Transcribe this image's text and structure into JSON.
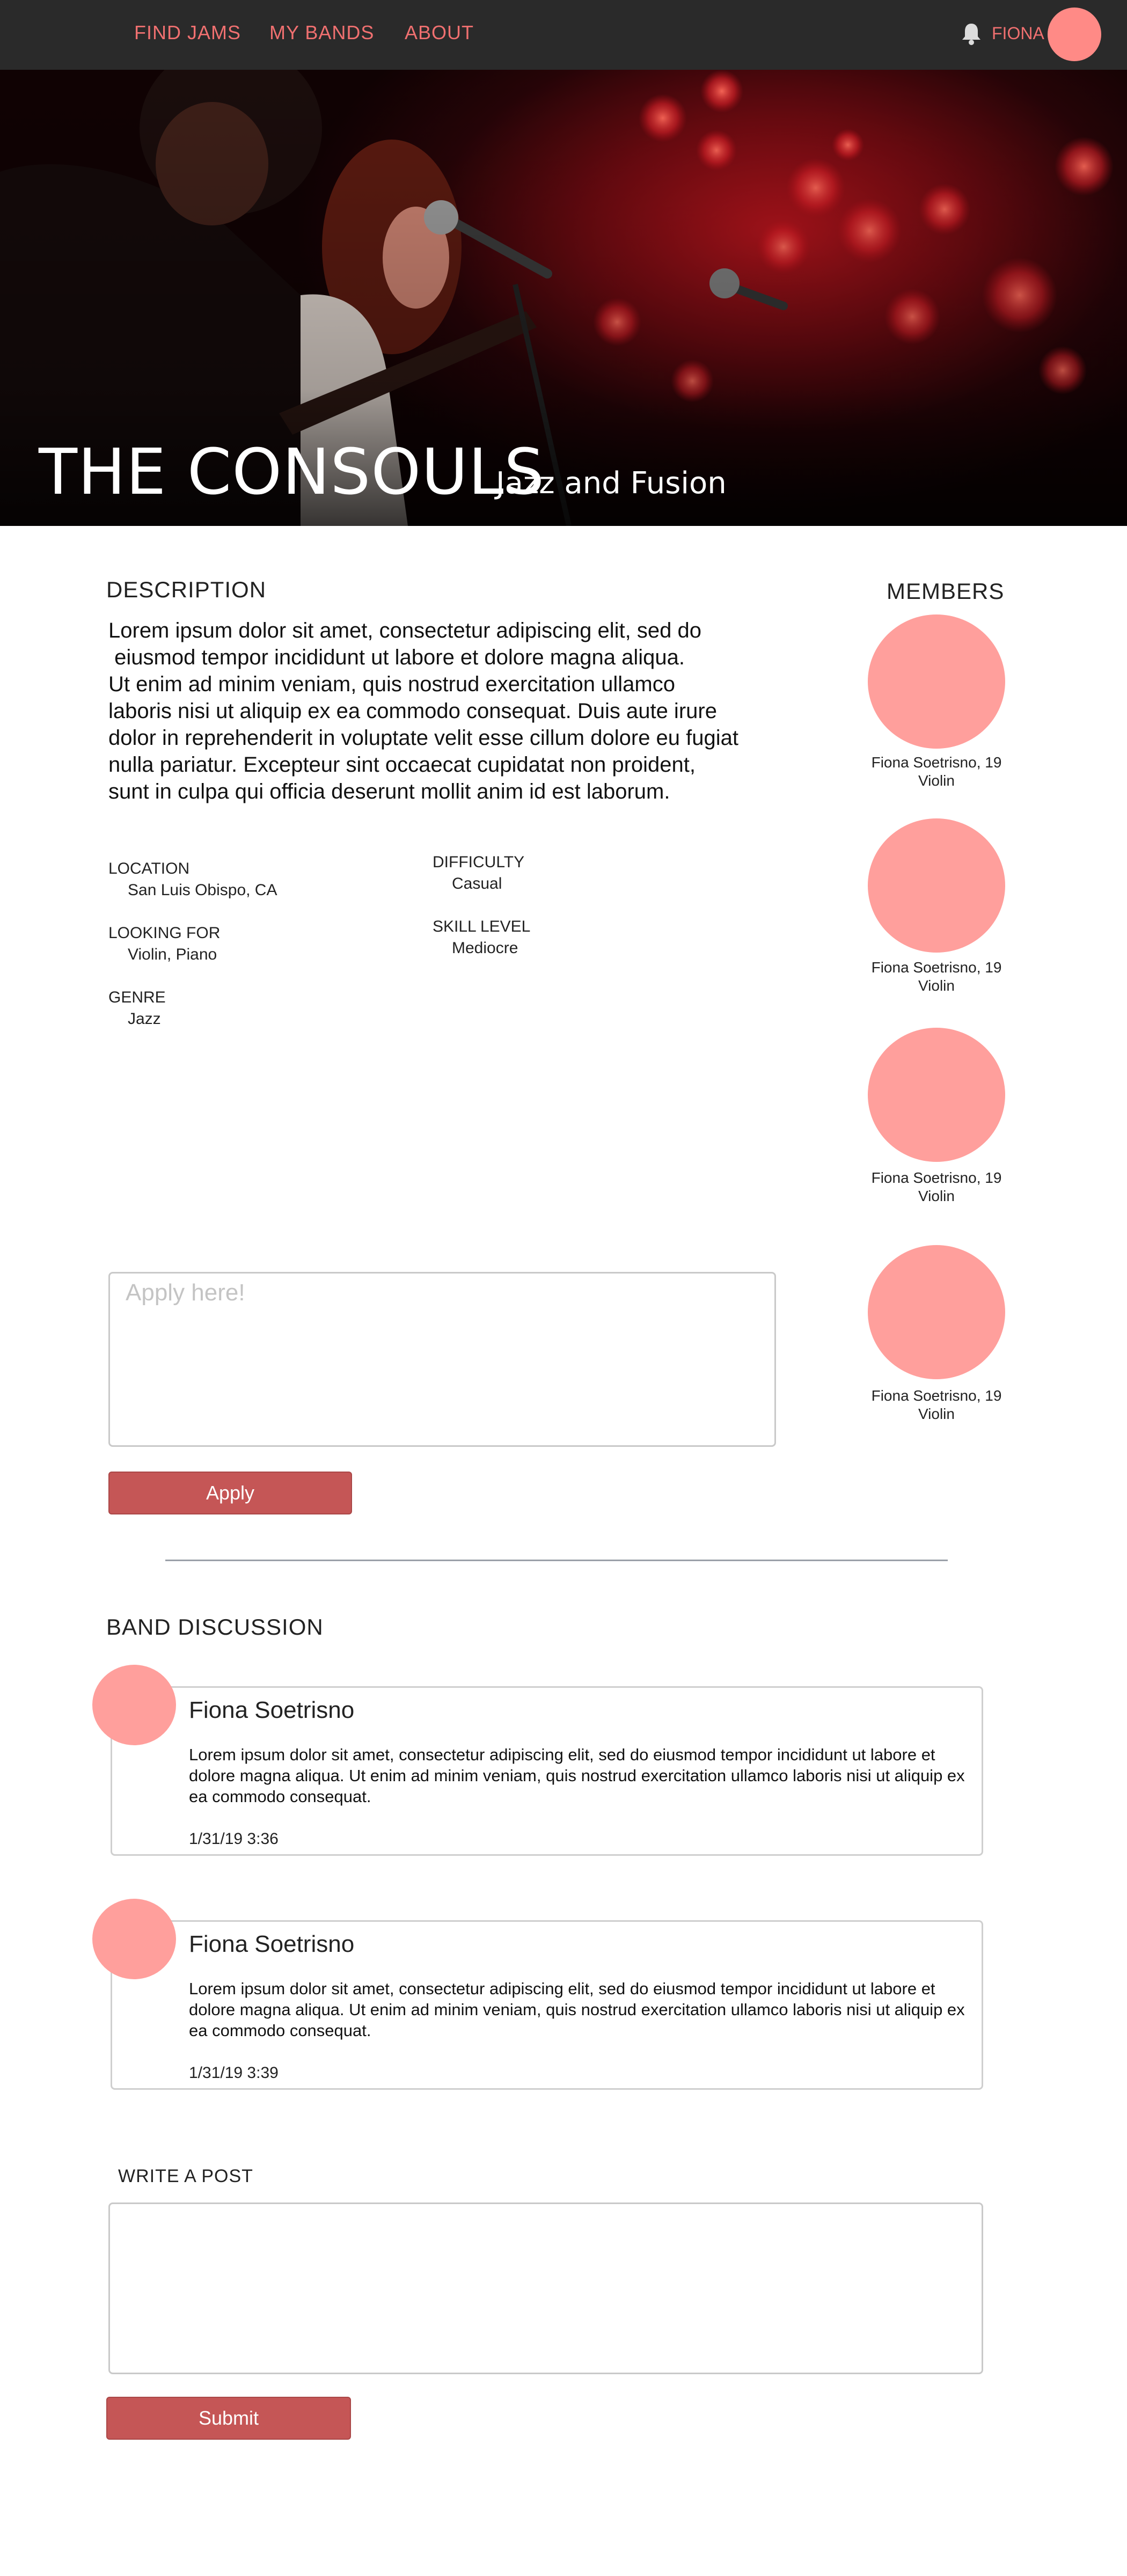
{
  "nav": {
    "links": [
      "FIND JAMS",
      "MY BANDS",
      "ABOUT"
    ],
    "user_name": "FIONA",
    "bell_icon": "bell-icon"
  },
  "colors": {
    "nav_bg": "#2a2a2a",
    "accent": "#f07070",
    "avatar": "#ff9f9c",
    "button": "#c55656"
  },
  "band": {
    "name": "THE CONSOULS",
    "genre_tagline": "Jazz and Fusion"
  },
  "description": {
    "heading": "DESCRIPTION",
    "text": "Lorem ipsum dolor sit amet, consectetur adipiscing elit, sed do\n eiusmod tempor incididunt ut labore et dolore magna aliqua.\nUt enim ad minim veniam, quis nostrud exercitation ullamco\nlaboris nisi ut aliquip ex ea commodo consequat. Duis aute irure\ndolor in reprehenderit in voluptate velit esse cillum dolore eu fugiat\nnulla pariatur. Excepteur sint occaecat cupidatat non proident,\nsunt in culpa qui officia deserunt mollit anim id est laborum."
  },
  "details": {
    "location": {
      "label": "LOCATION",
      "value": "San Luis Obispo, CA"
    },
    "looking_for": {
      "label": "LOOKING FOR",
      "value": "Violin, Piano"
    },
    "genre": {
      "label": "GENRE",
      "value": "Jazz"
    },
    "difficulty": {
      "label": "DIFFICULTY",
      "value": "Casual"
    },
    "skill_level": {
      "label": "SKILL LEVEL",
      "value": "Mediocre"
    }
  },
  "members": {
    "heading": "MEMBERS",
    "list": [
      {
        "line1": "Fiona Soetrisno, 19",
        "line2": "Violin"
      },
      {
        "line1": "Fiona Soetrisno, 19",
        "line2": "Violin"
      },
      {
        "line1": "Fiona Soetrisno, 19",
        "line2": "Violin"
      },
      {
        "line1": "Fiona Soetrisno, 19",
        "line2": "Violin"
      }
    ]
  },
  "apply": {
    "placeholder": "Apply here!",
    "button_label": "Apply"
  },
  "discussion": {
    "heading": "BAND DISCUSSION",
    "posts": [
      {
        "author": "Fiona Soetrisno",
        "body": "Lorem ipsum dolor sit amet, consectetur adipiscing elit, sed do eiusmod tempor incididunt ut labore et dolore magna aliqua. Ut enim ad minim veniam, quis nostrud exercitation ullamco laboris nisi ut aliquip ex ea commodo consequat.",
        "time": "1/31/19 3:36"
      },
      {
        "author": "Fiona Soetrisno",
        "body": "Lorem ipsum dolor sit amet, consectetur adipiscing elit, sed do eiusmod tempor incididunt ut labore et dolore magna aliqua. Ut enim ad minim veniam, quis nostrud exercitation ullamco laboris nisi ut aliquip ex ea commodo consequat.",
        "time": "1/31/19 3:39"
      }
    ]
  },
  "write_post": {
    "heading": "WRITE A POST",
    "button_label": "Submit"
  }
}
